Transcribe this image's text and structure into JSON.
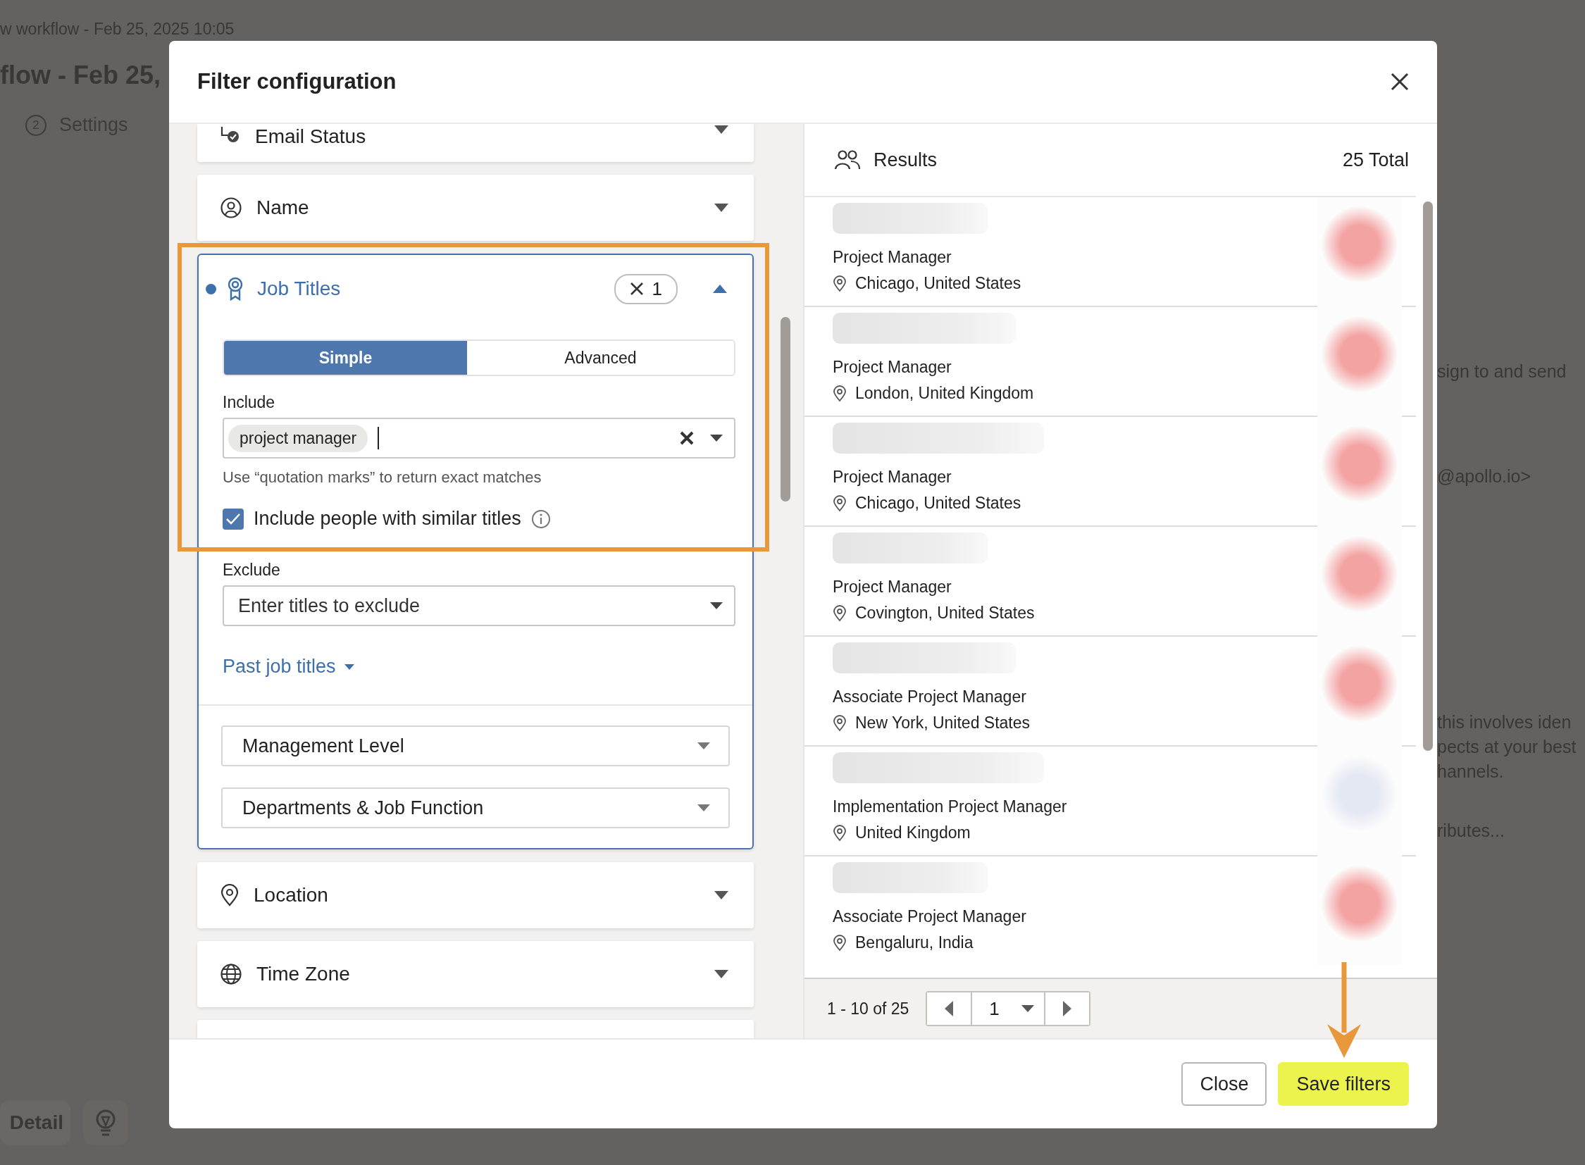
{
  "background": {
    "breadcrumb": "w workflow - Feb 25, 2025 10:05",
    "title": "flow - Feb 25,",
    "step": {
      "number": "2",
      "label": "Settings"
    },
    "side_texts": [
      "sign to and send",
      "@apollo.io>",
      "this involves iden",
      "pects at your best",
      "hannels.",
      "ributes..."
    ],
    "toolbar": {
      "detail": "Detail"
    }
  },
  "dialog": {
    "title": "Filter configuration",
    "filters": [
      {
        "label": "Email Status",
        "expanded": false
      },
      {
        "label": "Name",
        "expanded": false
      },
      {
        "label": "Job Titles",
        "expanded": true,
        "count": "1",
        "modes": [
          {
            "label": "Simple",
            "selected": true
          },
          {
            "label": "Advanced",
            "selected": false
          }
        ],
        "include": {
          "label": "Include",
          "tags": [
            "project manager"
          ]
        },
        "hint": "Use “quotation marks” to return exact matches",
        "similar": {
          "label": "Include people with similar titles",
          "checked": true
        },
        "exclude": {
          "label": "Exclude",
          "placeholder": "Enter titles to exclude"
        },
        "past_titles": "Past job titles",
        "subfilters": [
          "Management Level",
          "Departments & Job Function"
        ]
      },
      {
        "label": "Location",
        "expanded": false
      },
      {
        "label": "Time Zone",
        "expanded": false
      }
    ],
    "results": {
      "title": "Results",
      "total": "25 Total",
      "rows": [
        {
          "title": "Project Manager",
          "location": "Chicago, United States",
          "color": "#f4a3a3"
        },
        {
          "title": "Project Manager",
          "location": "London, United Kingdom",
          "color": "#f4a3a3"
        },
        {
          "title": "Project Manager",
          "location": "Chicago, United States",
          "color": "#f4a3a3"
        },
        {
          "title": "Project Manager",
          "location": "Covington, United States",
          "color": "#f4a3a3"
        },
        {
          "title": "Associate Project Manager",
          "location": "New York, United States",
          "color": "#f4a3a3"
        },
        {
          "title": "Implementation Project Manager",
          "location": "United Kingdom",
          "color": "#e4e8f2"
        },
        {
          "title": "Associate Project Manager",
          "location": "Bengaluru, India",
          "color": "#f4a3a3"
        }
      ],
      "pagination": {
        "range": "1 - 10 of 25",
        "page": "1"
      }
    },
    "buttons": [
      {
        "label": "Close",
        "kind": "secondary"
      },
      {
        "label": "Save filters",
        "kind": "primary"
      }
    ]
  }
}
